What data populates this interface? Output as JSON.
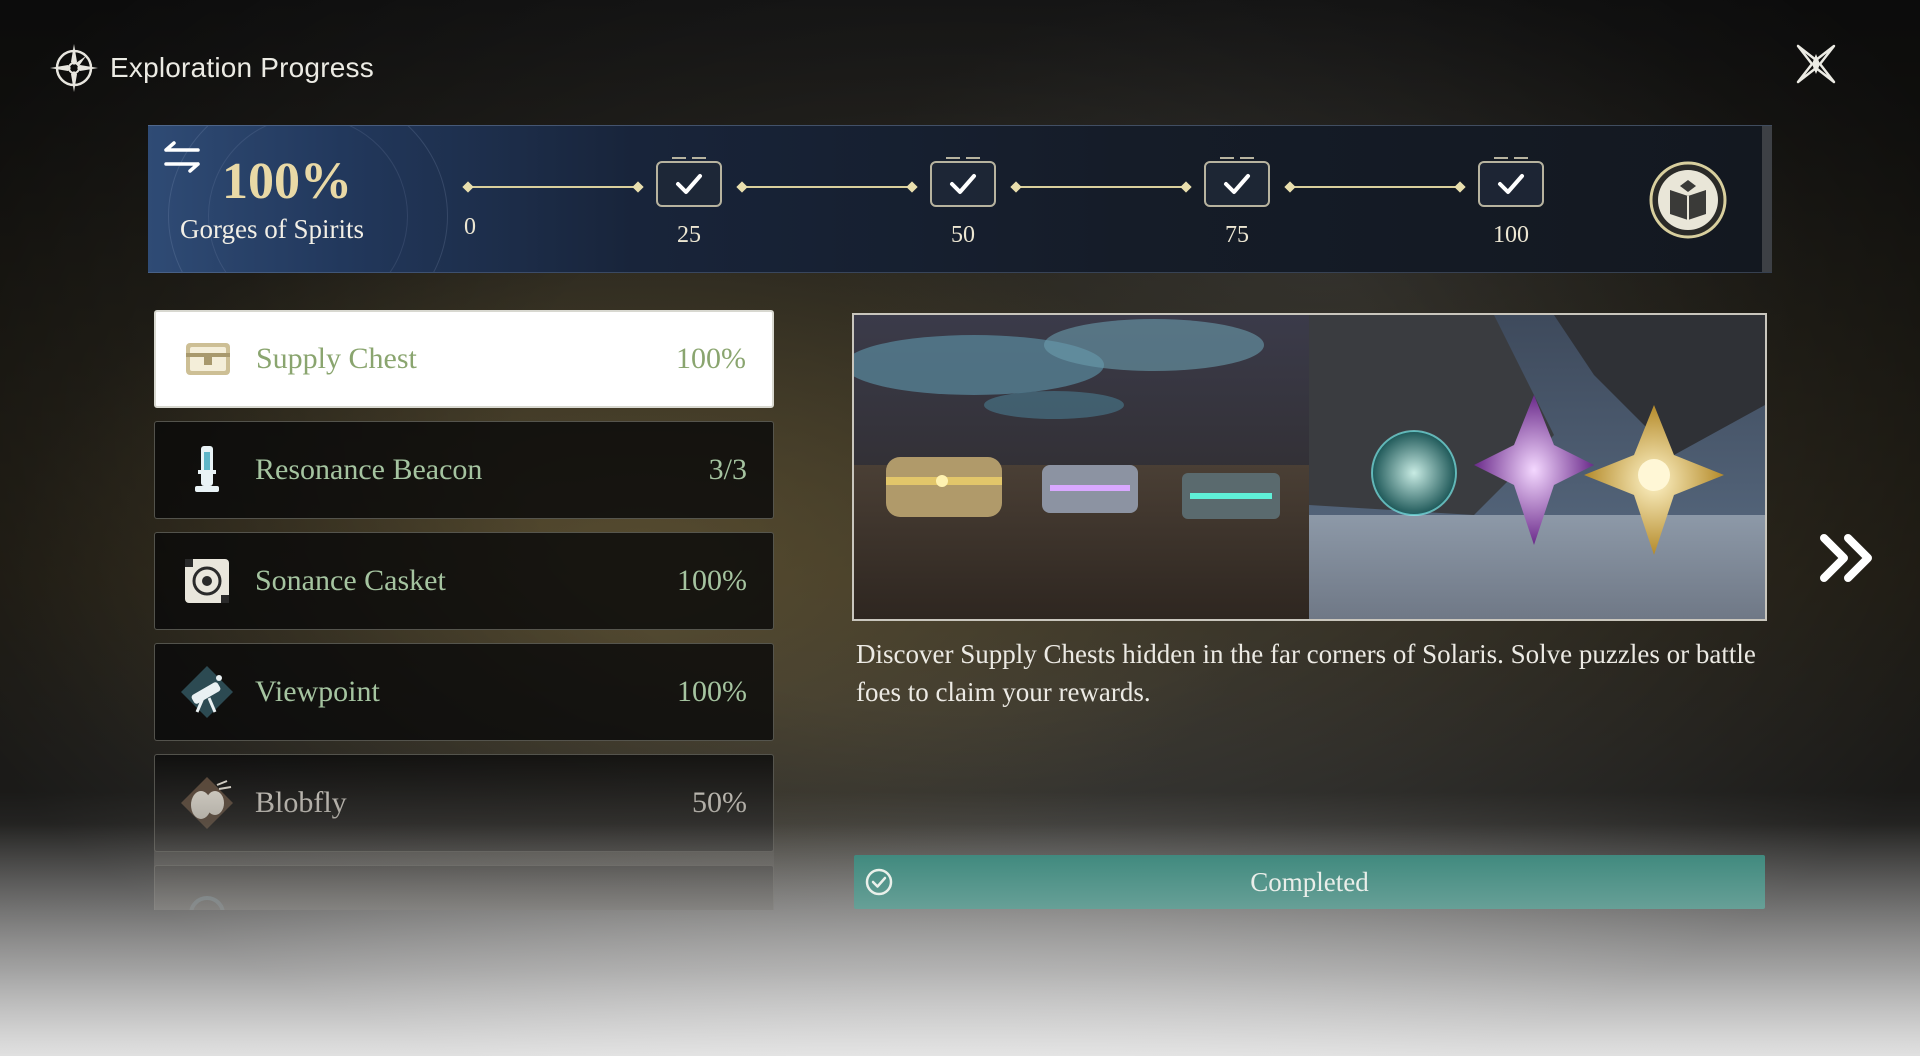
{
  "header": {
    "title": "Exploration Progress"
  },
  "banner": {
    "percent": "100%",
    "region": "Gorges of Spirits",
    "milestones": [
      "0",
      "25",
      "50",
      "75",
      "100"
    ]
  },
  "categories": [
    {
      "name": "Supply Chest",
      "value": "100%",
      "icon": "supply-chest-icon",
      "selected": true
    },
    {
      "name": "Resonance Beacon",
      "value": "3/3",
      "icon": "resonance-beacon-icon"
    },
    {
      "name": "Sonance Casket",
      "value": "100%",
      "icon": "sonance-casket-icon"
    },
    {
      "name": "Viewpoint",
      "value": "100%",
      "icon": "viewpoint-icon"
    },
    {
      "name": "Blobfly",
      "value": "50%",
      "icon": "blobfly-icon"
    }
  ],
  "detail": {
    "description": "Discover Supply Chests hidden in the far corners of Solaris. Solve puzzles or battle foes to claim your rewards.",
    "status": "Completed"
  },
  "colors": {
    "accent_gold": "#e9d9a6",
    "category_text": "#a5c4a0",
    "completed_bar": "#2a7d70"
  }
}
